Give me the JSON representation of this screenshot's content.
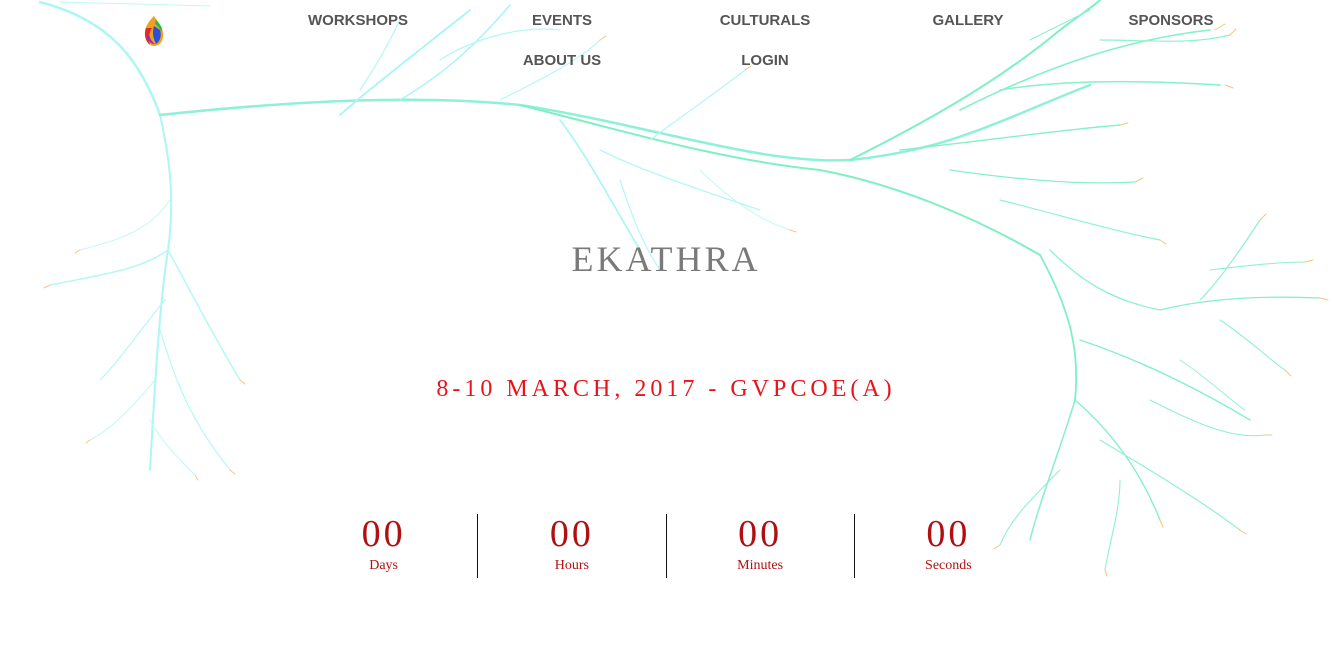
{
  "nav": {
    "workshops": "WORKSHOPS",
    "events": "EVENTS",
    "culturals": "CULTURALS",
    "gallery": "GALLERY",
    "sponsors": "SPONSORS",
    "about": "ABOUT US",
    "login": "LOGIN"
  },
  "hero": {
    "title": "EKATHRA",
    "dateline": "8-10 MARCH, 2017 - GVPCOE(A)"
  },
  "countdown": {
    "days": {
      "value": "00",
      "label": "Days"
    },
    "hours": {
      "value": "00",
      "label": "Hours"
    },
    "minutes": {
      "value": "00",
      "label": "Minutes"
    },
    "seconds": {
      "value": "00",
      "label": "Seconds"
    }
  },
  "colors": {
    "nav_text": "#555555",
    "title": "#7a7a7a",
    "dateline": "#e8141b",
    "countdown": "#b01010",
    "branch_cyan": "#9ff5f5",
    "branch_green": "#7ef0c4",
    "branch_tips": "#f5c77a"
  }
}
